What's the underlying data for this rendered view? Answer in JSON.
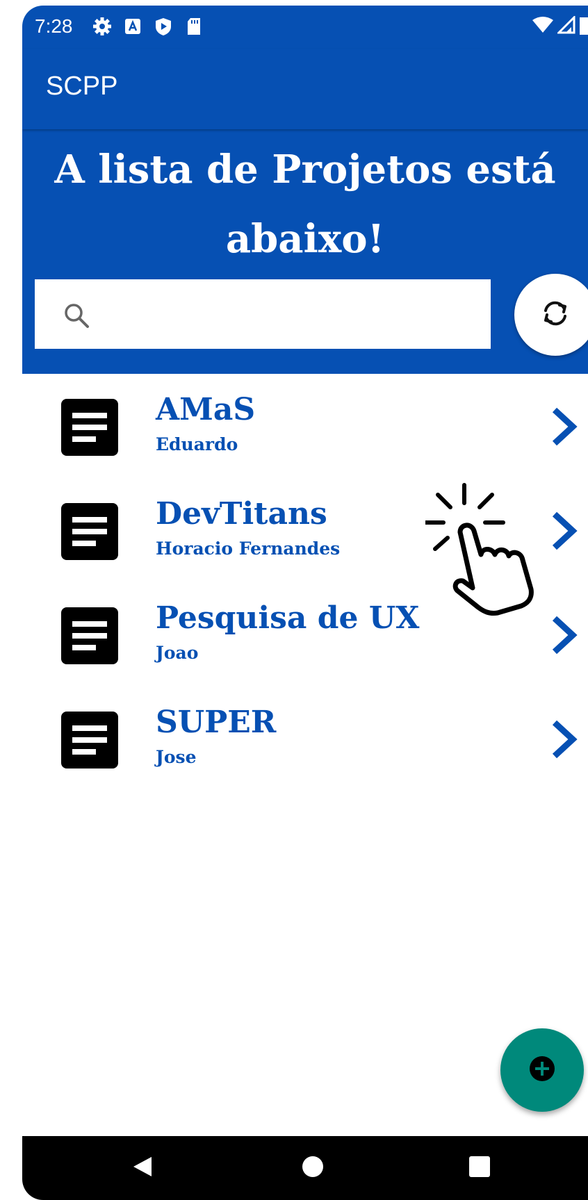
{
  "status_bar": {
    "time": "7:28",
    "icons": [
      "settings-icon",
      "font-icon",
      "shield-icon",
      "sd-card-icon"
    ],
    "right_icons": [
      "wifi-icon",
      "signal-icon",
      "battery-icon"
    ]
  },
  "app_bar": {
    "title": "SCPP"
  },
  "hero": {
    "title": "A lista de Projetos está abaixo!"
  },
  "search": {
    "value": "",
    "placeholder": "",
    "icon": "search-icon"
  },
  "refresh_button": {
    "icon": "refresh-icon"
  },
  "projects": [
    {
      "name": "AMaS",
      "owner": "Eduardo"
    },
    {
      "name": "DevTitans",
      "owner": "Horacio Fernandes"
    },
    {
      "name": "Pesquisa de UX",
      "owner": "Joao"
    },
    {
      "name": "SUPER",
      "owner": "Jose"
    }
  ],
  "fab": {
    "icon": "add-icon"
  },
  "nav_bar": {
    "buttons": [
      "back-icon",
      "home-icon",
      "recents-icon"
    ]
  },
  "colors": {
    "primary": "#0650B3",
    "fab": "#00897B",
    "text_on_primary": "#FFFFFF"
  }
}
